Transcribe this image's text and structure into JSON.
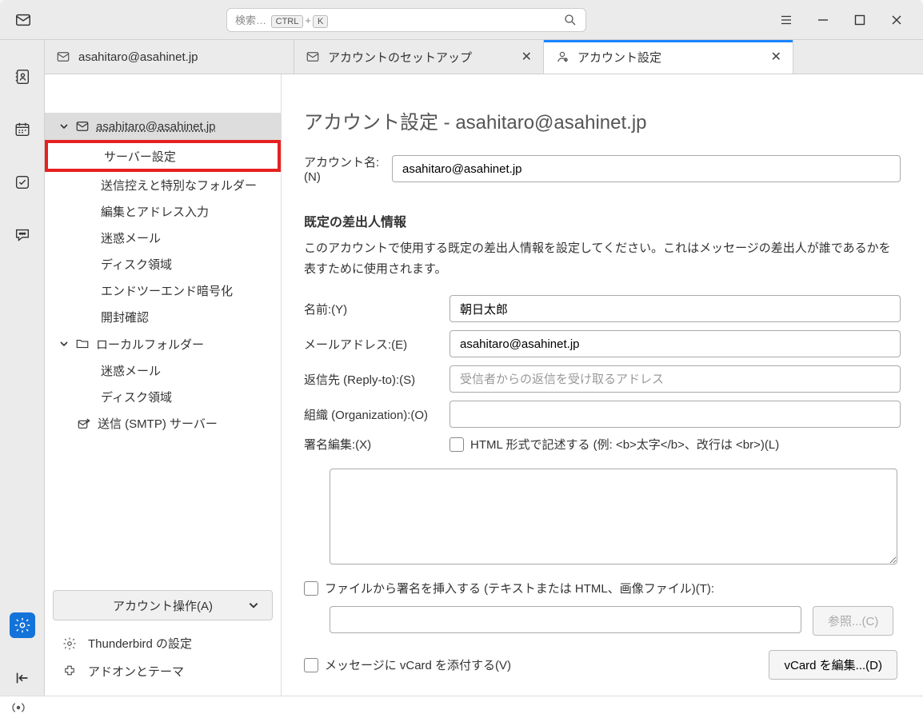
{
  "search": {
    "prefix": "検索…",
    "kbd1": "CTRL",
    "plus": "+",
    "kbd2": "K"
  },
  "tabs": [
    {
      "label": "asahitaro@asahinet.jp"
    },
    {
      "label": "アカウントのセットアップ"
    },
    {
      "label": "アカウント設定"
    }
  ],
  "tree": {
    "account": "asahitaro@asahinet.jp",
    "items1": [
      "サーバー設定",
      "送信控えと特別なフォルダー",
      "編集とアドレス入力",
      "迷惑メール",
      "ディスク領域",
      "エンドツーエンド暗号化",
      "開封確認"
    ],
    "local": "ローカルフォルダー",
    "items2": [
      "迷惑メール",
      "ディスク領域"
    ],
    "smtp": "送信 (SMTP) サーバー",
    "actions": "アカウント操作(A)",
    "pref": "Thunderbird の設定",
    "addon": "アドオンとテーマ"
  },
  "form": {
    "title": "アカウント設定 - asahitaro@asahinet.jp",
    "accountNameLabel": "アカウント名:(N)",
    "accountName": "asahitaro@asahinet.jp",
    "identityHead": "既定の差出人情報",
    "identityDesc": "このアカウントで使用する既定の差出人情報を設定してください。これはメッセージの差出人が誰であるかを表すために使用されます。",
    "nameLabel": "名前:(Y)",
    "name": "朝日太郎",
    "emailLabel": "メールアドレス:(E)",
    "email": "asahitaro@asahinet.jp",
    "replyLabel": "返信先 (Reply-to):(S)",
    "replyPlaceholder": "受信者からの返信を受け取るアドレス",
    "orgLabel": "組織 (Organization):(O)",
    "sigLabel": "署名編集:(X)",
    "sigHtml": "HTML 形式で記述する (例: <b>太字</b>、改行は <br>)(L)",
    "fileSig": "ファイルから署名を挿入する (テキストまたは HTML、画像ファイル)(T):",
    "browse": "参照...(C)",
    "vcardAttach": "メッセージに vCard を添付する(V)",
    "vcardEdit": "vCard を編集...(D)"
  }
}
